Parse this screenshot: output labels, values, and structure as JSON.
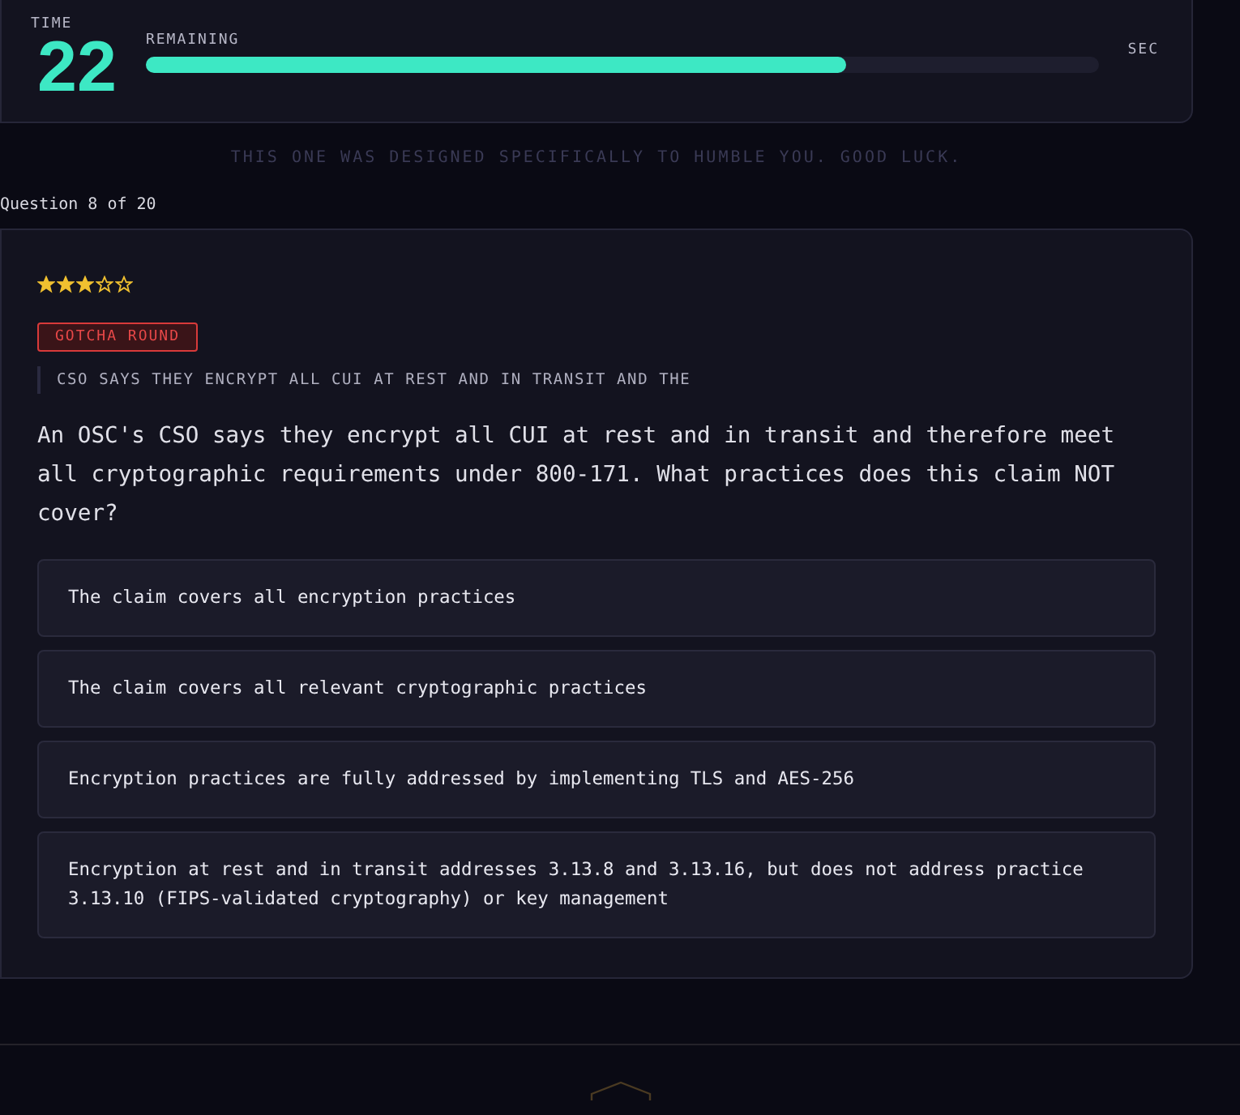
{
  "timer": {
    "label": "TIME",
    "value": "22",
    "progress_label": "REMAINING",
    "level": 0.735,
    "unit": "SEC"
  },
  "taunt": "THIS ONE WAS DESIGNED SPECIFICALLY TO HUMBLE YOU. GOOD LUCK.",
  "progress": "Question 8 of 20",
  "question": {
    "stars": 3,
    "badge": "GOTCHA ROUND",
    "scenario": "CSO SAYS THEY ENCRYPT ALL CUI AT REST AND IN TRANSIT AND THE",
    "text": "An OSC's CSO says they encrypt all CUI at rest and in transit and therefore meet all cryptographic requirements under 800-171. What practices does this claim NOT cover?",
    "options": [
      {
        "text": "The claim covers all encryption practices"
      },
      {
        "text": "The claim covers all relevant cryptographic practices"
      },
      {
        "text": "Encryption practices are fully addressed by implementing TLS and AES-256"
      },
      {
        "text": "Encryption at rest and in transit addresses 3.13.8 and 3.13.16, but does not address practice 3.13.10 (FIPS-validated cryptography) or key management"
      }
    ]
  }
}
